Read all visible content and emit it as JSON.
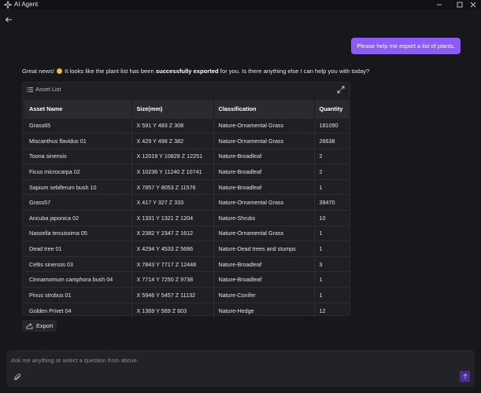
{
  "app": {
    "title": "AI Agent"
  },
  "window_controls": {
    "minimize": "—",
    "maximize": "☐",
    "close": "✕"
  },
  "user_message": "Please help me export a list of plants.",
  "assistant": {
    "text_before": "Great news! ",
    "text_middle": " It looks like the plant list has been ",
    "bold_text": "successfully exported",
    "text_after": " for you. Is there anything else I can help you with today?"
  },
  "asset_list": {
    "title": "Asset List",
    "columns": [
      "Asset Name",
      "Size(mm)",
      "Classification",
      "Quantity"
    ],
    "rows": [
      [
        "Grass65",
        "X 591 Y 483 Z 308",
        "Nature-Ornamental Grass",
        "181090"
      ],
      [
        "Miscanthus flavidus 01",
        "X 429 Y 498 Z 382",
        "Nature-Ornamental Grass",
        "26638"
      ],
      [
        "Toona sinensis",
        "X 12019 Y 10828 Z 12251",
        "Nature-Broadleaf",
        "2"
      ],
      [
        "Ficus microcarpa 02",
        "X 10236 Y 11240 Z 10741",
        "Nature-Broadleaf",
        "2"
      ],
      [
        "Sapium sebiferum bush 10",
        "X 7857 Y 8053 Z 11576",
        "Nature-Broadleaf",
        "1"
      ],
      [
        "Grass57",
        "X 417 Y 327 Z 333",
        "Nature-Ornamental Grass",
        "39470"
      ],
      [
        "Ancuba japonica 02",
        "X 1331 Y 1321 Z 1204",
        "Nature-Shrubs",
        "10"
      ],
      [
        "Nassella tenuissima 05",
        "X 2382 Y 2347 Z 1612",
        "Nature-Ornamental Grass",
        "1"
      ],
      [
        "Dead tree 01",
        "X 4294 Y 4533 Z 5686",
        "Nature-Dead trees and stumps",
        "1"
      ],
      [
        "Celtis sinensis 03",
        "X 7843 Y 7717 Z 12448",
        "Nature-Broadleaf",
        "3"
      ],
      [
        "Cinnamomum camphora bush 04",
        "X 7714 Y 7250 Z 9738",
        "Nature-Broadleaf",
        "1"
      ],
      [
        "Pinus strobus 01",
        "X 5946 Y 5457 Z 11132",
        "Nature-Conifer",
        "1"
      ],
      [
        "Golden Privet 04",
        "X 1369 Y 569 Z 603",
        "Nature-Hedge",
        "12"
      ]
    ]
  },
  "export_button": "Export",
  "composer": {
    "placeholder": "Ask me anything or select a question from above."
  },
  "colors": {
    "accent": "#8b5cf6",
    "background": "#17181c",
    "send_button": "#4a2f8f"
  }
}
